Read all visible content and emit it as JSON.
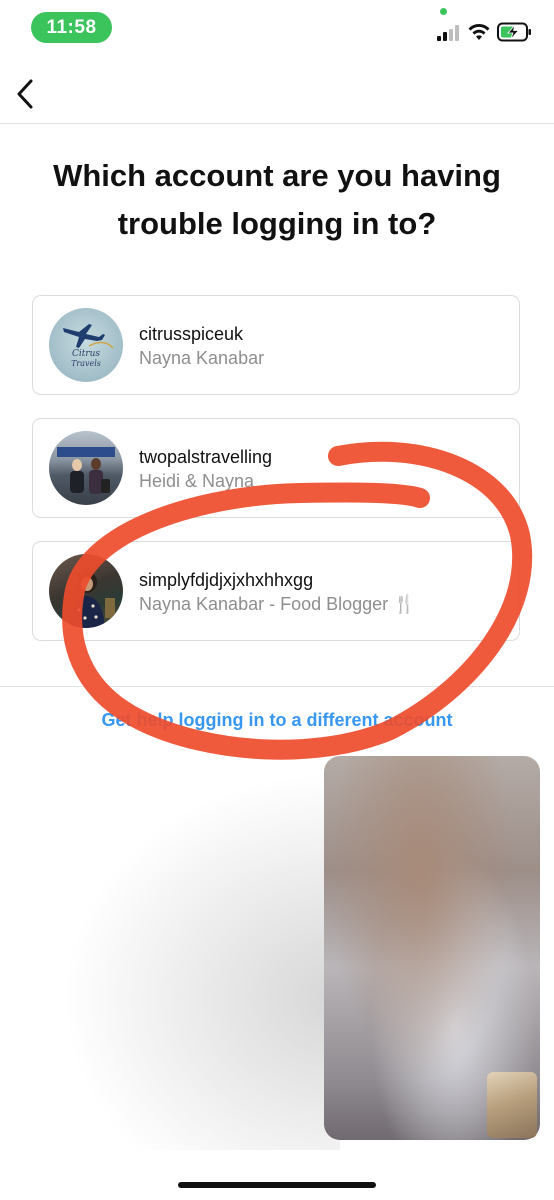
{
  "status_bar": {
    "time": "11:58",
    "icons": [
      "camera-dot-icon",
      "signal-icon",
      "wifi-icon",
      "battery-charging-icon"
    ],
    "accent_color": "#3bc45c"
  },
  "header": {
    "back_icon": "chevron-left-icon"
  },
  "title": {
    "line1": "Which account are you having",
    "line2": "trouble logging in to?"
  },
  "accounts": [
    {
      "username": "citrusspiceuk",
      "name": "Nayna Kanabar"
    },
    {
      "username": "twopalstravelling",
      "name": "Heidi & Nayna"
    },
    {
      "username": "simplyfdjdjxjxhxhhxgg",
      "name": "Nayna Kanabar - Food Blogger 🍴"
    }
  ],
  "help_link": "Get help logging in to a different account",
  "colors": {
    "link": "#3897f0",
    "annotation": "#ee4c2c"
  }
}
